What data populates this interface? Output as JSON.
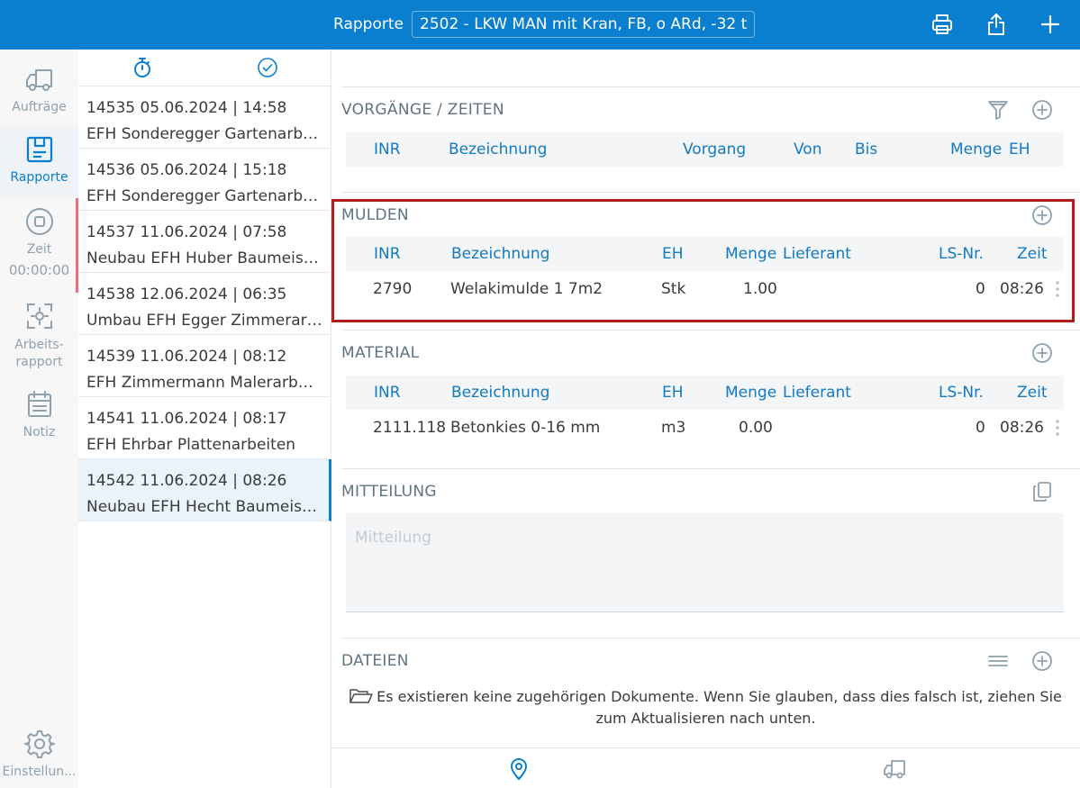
{
  "header": {
    "title": "Rapporte",
    "vehicle_select": "2502 - LKW MAN mit Kran, FB, o ARd, -32 t",
    "icons": [
      "printer-icon",
      "share-icon",
      "plus-icon"
    ]
  },
  "nav": {
    "items": [
      {
        "label": "Aufträge",
        "icon": "truck-icon"
      },
      {
        "label": "Rapporte",
        "icon": "report-icon"
      },
      {
        "label": "Zeit",
        "icon": "stop-icon"
      },
      {
        "label": "Arbeits-rapport",
        "icon": "scan-icon"
      },
      {
        "label": "Notiz",
        "icon": "calendar-icon"
      },
      {
        "label": "Einstellun...",
        "icon": "gear-icon"
      }
    ],
    "timer": "00:00:00",
    "accent_color": "#0a7ecf"
  },
  "list": {
    "tab_icons": [
      "stopwatch-icon",
      "check-circle-icon"
    ],
    "items": [
      {
        "header": "14535  05.06.2024 | 14:58",
        "title": "EFH Sonderegger Gartenarbeiten"
      },
      {
        "header": "14536  05.06.2024 | 15:18",
        "title": "EFH Sonderegger Gartenarbeiten"
      },
      {
        "header": "14537  11.06.2024 | 07:58",
        "title": "Neubau EFH Huber Baumeisterarbeiten"
      },
      {
        "header": "14538  12.06.2024 | 06:35",
        "title": "Umbau EFH Egger Zimmerarbeiten"
      },
      {
        "header": "14539  11.06.2024 | 08:12",
        "title": "EFH Zimmermann Malerarbeiten"
      },
      {
        "header": "14541  11.06.2024 | 08:17",
        "title": "EFH Ehrbar Plattenarbeiten"
      },
      {
        "header": "14542  11.06.2024 | 08:26",
        "title": "Neubau EFH Hecht Baumeisterarbeiten"
      }
    ]
  },
  "sections": {
    "vorgaenge": {
      "title": "VORGÄNGE / ZEITEN",
      "columns": [
        "INR",
        "Bezeichnung",
        "Vorgang",
        "Von",
        "Bis",
        "Menge",
        "EH"
      ]
    },
    "mulden": {
      "title": "MULDEN",
      "columns": [
        "INR",
        "Bezeichnung",
        "EH",
        "Menge",
        "Lieferant",
        "LS-Nr.",
        "Zeit"
      ],
      "rows": [
        {
          "inr": "2790",
          "bezeichnung": "Welakimulde 1 7m2",
          "eh": "Stk",
          "menge": "1.00",
          "lieferant": "",
          "lsnr": "0",
          "zeit": "08:26"
        }
      ]
    },
    "material": {
      "title": "MATERIAL",
      "columns": [
        "INR",
        "Bezeichnung",
        "EH",
        "Menge",
        "Lieferant",
        "LS-Nr.",
        "Zeit"
      ],
      "rows": [
        {
          "inr": "2111.118",
          "bezeichnung": "Betonkies 0-16 mm",
          "eh": "m3",
          "menge": "0.00",
          "lieferant": "",
          "lsnr": "0",
          "zeit": "08:26"
        }
      ]
    },
    "mitteilung": {
      "title": "MITTEILUNG",
      "placeholder": "Mitteilung"
    },
    "dateien": {
      "title": "DATEIEN",
      "empty_message": "Es existieren keine zugehörigen Dokumente. Wenn Sie glauben, dass dies falsch ist, ziehen Sie zum Aktualisieren nach unten."
    }
  },
  "bottom_bar": {
    "icons": [
      "location-pin-icon",
      "truck-icon"
    ]
  }
}
